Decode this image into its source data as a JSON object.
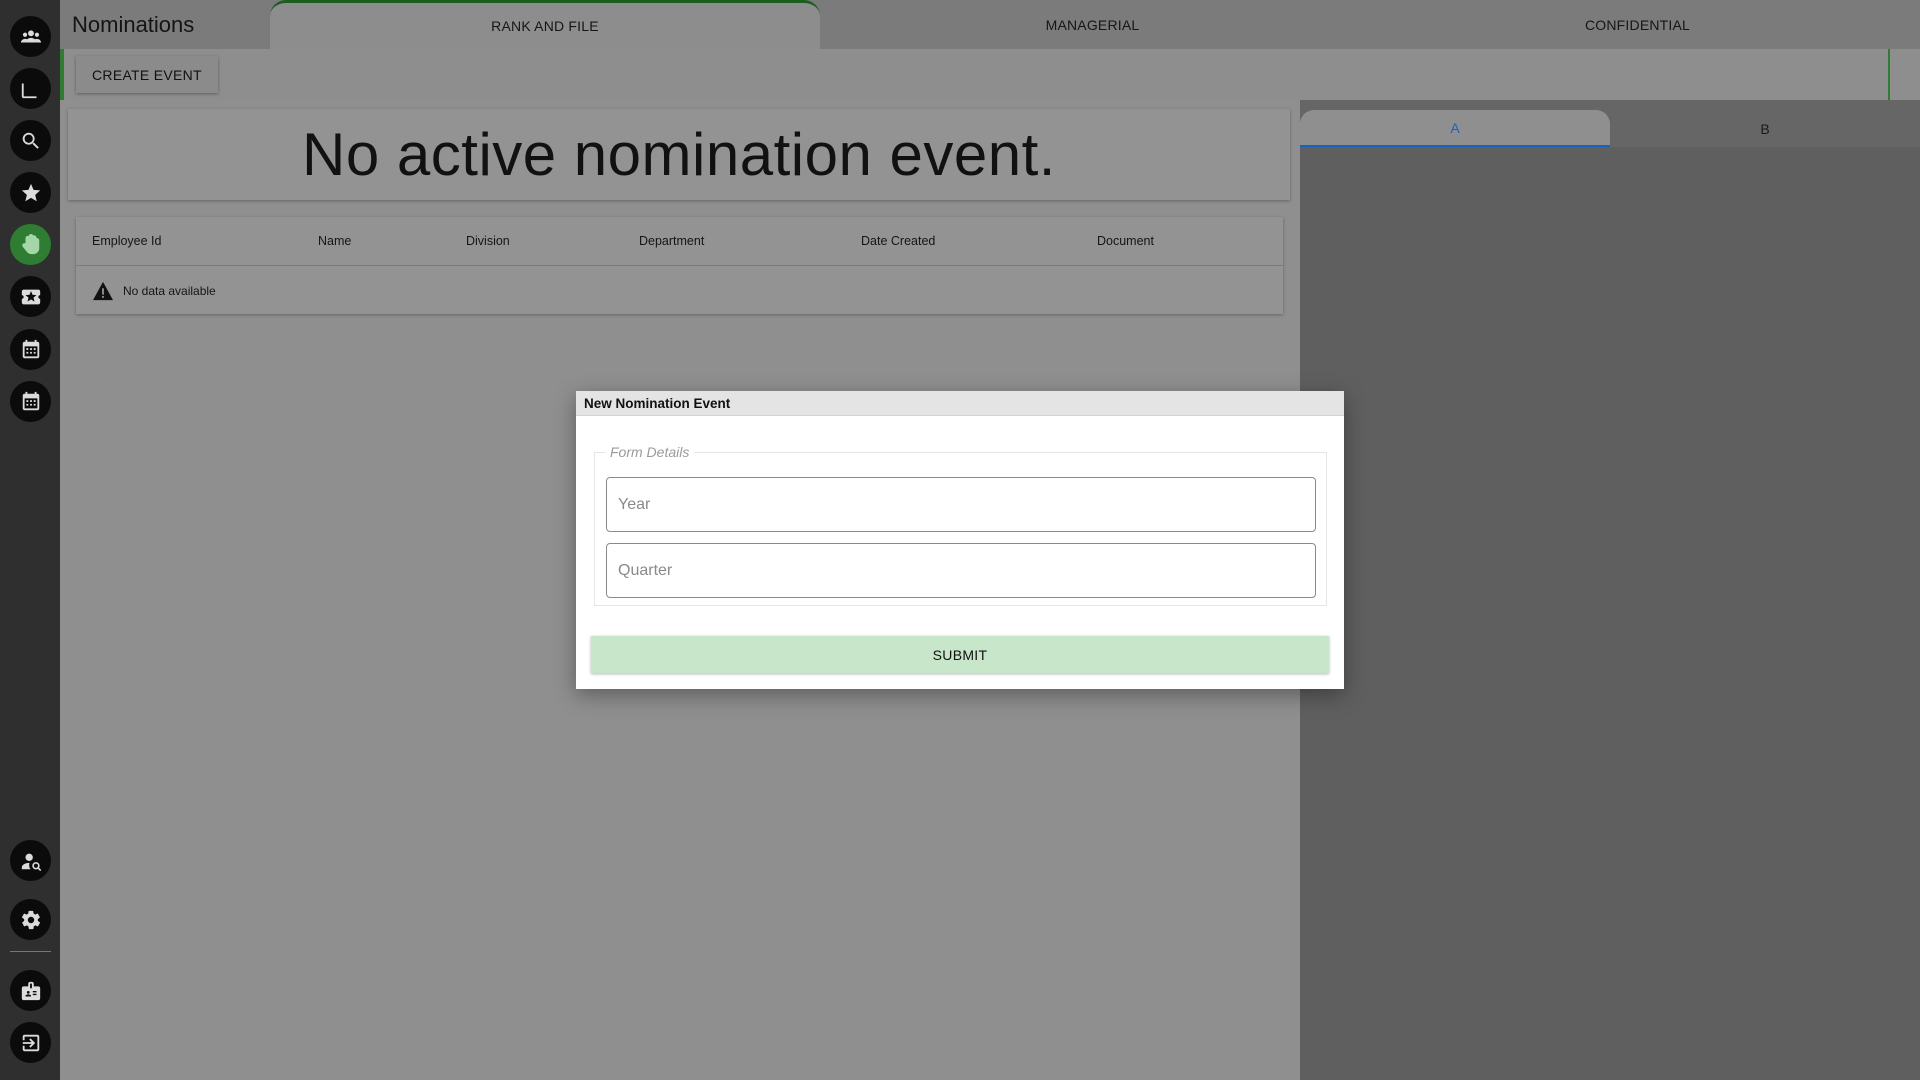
{
  "app": {
    "title": "Nominations"
  },
  "tabs": [
    {
      "label": "RANK AND FILE",
      "active": true
    },
    {
      "label": "MANAGERIAL",
      "active": false
    },
    {
      "label": "CONFIDENTIAL",
      "active": false
    }
  ],
  "toolbar": {
    "create_label": "CREATE EVENT"
  },
  "main": {
    "empty_message": "No active nomination event.",
    "table": {
      "columns": [
        "Employee Id",
        "Name",
        "Division",
        "Department",
        "Date Created",
        "Document"
      ],
      "no_data": "No data available"
    }
  },
  "right_panel": {
    "tabs": [
      "A",
      "B"
    ],
    "active_tab": "A"
  },
  "dialog": {
    "title": "New Nomination Event",
    "legend": "Form Details",
    "year_placeholder": "Year",
    "quarter_placeholder": "Quarter",
    "submit_label": "SUBMIT"
  },
  "sidebar": {
    "icons": [
      "people-icon",
      "help-book-icon",
      "search-icon",
      "star-icon",
      "hand-icon",
      "ticket-icon",
      "calendar-icon",
      "calendar-alt-icon",
      "user-search-icon",
      "gear-icon",
      "badge-icon",
      "logout-icon"
    ],
    "active_icon": "hand-icon"
  },
  "colors": {
    "accent_green": "#2e7d32",
    "submit_bg": "#c8e6c9",
    "tab_blue": "#1565c0"
  }
}
